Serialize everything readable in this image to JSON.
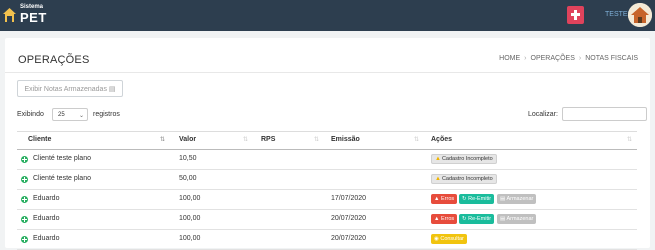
{
  "app": {
    "logo_small": "Sistema",
    "logo_big": "PET",
    "user": "TESTE2"
  },
  "page": {
    "title": "OPERAÇÕES",
    "breadcrumb": [
      "HOME",
      "OPERAÇÕES",
      "NOTAS FISCAIS"
    ],
    "notes_button": "Exibir Notas Armazenadas",
    "show_label": "Exibindo",
    "page_size": "25",
    "records_label": "registros",
    "search_label": "Localizar:",
    "search_value": ""
  },
  "table": {
    "headers": [
      "Cliente",
      "Valor",
      "RPS",
      "Emissão",
      "Ações"
    ],
    "rows": [
      {
        "cliente": "Clienté teste plano",
        "valor": "10,50",
        "rps": "",
        "emissao": "",
        "acoes": [
          "Cadastro Incompleto"
        ]
      },
      {
        "cliente": "Clienté teste plano",
        "valor": "50,00",
        "rps": "",
        "emissao": "",
        "acoes": [
          "Cadastro Incompleto"
        ]
      },
      {
        "cliente": "Eduardo",
        "valor": "100,00",
        "rps": "",
        "emissao": "17/07/2020",
        "acoes": [
          "Erros",
          "Re-Emitir",
          "Armazenar"
        ]
      },
      {
        "cliente": "Eduardo",
        "valor": "100,00",
        "rps": "",
        "emissao": "20/07/2020",
        "acoes": [
          "Erros",
          "Re-Emitir",
          "Armazenar"
        ]
      },
      {
        "cliente": "Eduardo",
        "valor": "100,00",
        "rps": "",
        "emissao": "20/07/2020",
        "acoes": [
          "Consultar"
        ]
      }
    ]
  },
  "colors": {
    "topbar": "#2d3e4f",
    "accent": "#e0435c",
    "success": "#27ae60",
    "danger": "#e74c3c",
    "teal": "#1abc9c",
    "warning": "#f1c40f"
  }
}
